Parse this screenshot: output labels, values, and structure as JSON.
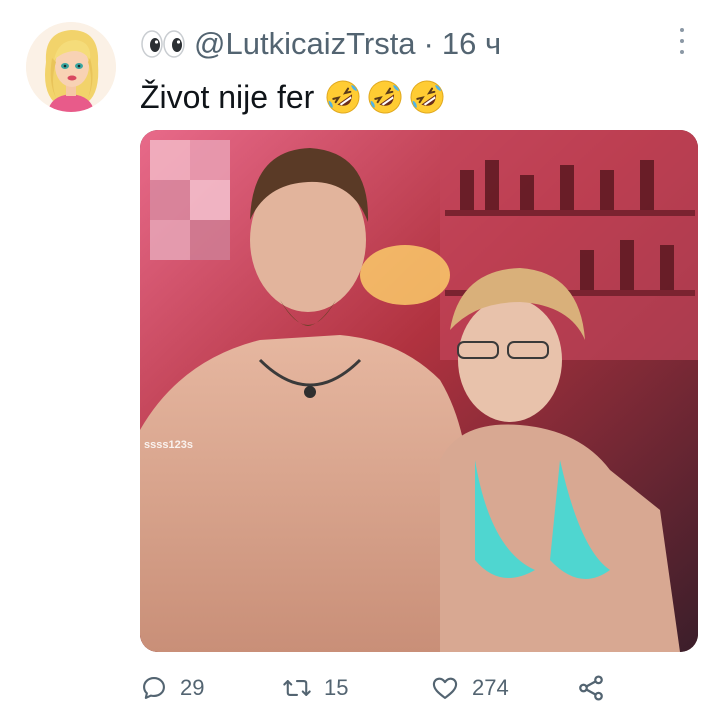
{
  "tweet": {
    "author_handle": "@LutkicaizTrsta",
    "separator": "·",
    "time": "16 ч",
    "text": "Život nije fer",
    "emoji_count": 3
  },
  "media": {
    "watermark": "ssss123s"
  },
  "actions": {
    "replies": "29",
    "retweets": "15",
    "likes": "274"
  },
  "icons": {
    "author_badge": "eyes-icon",
    "text_emoji": "rolling-on-floor-laughing-icon",
    "more": "more-vertical-icon",
    "reply": "reply-icon",
    "retweet": "retweet-icon",
    "like": "heart-icon",
    "share": "share-icon"
  }
}
